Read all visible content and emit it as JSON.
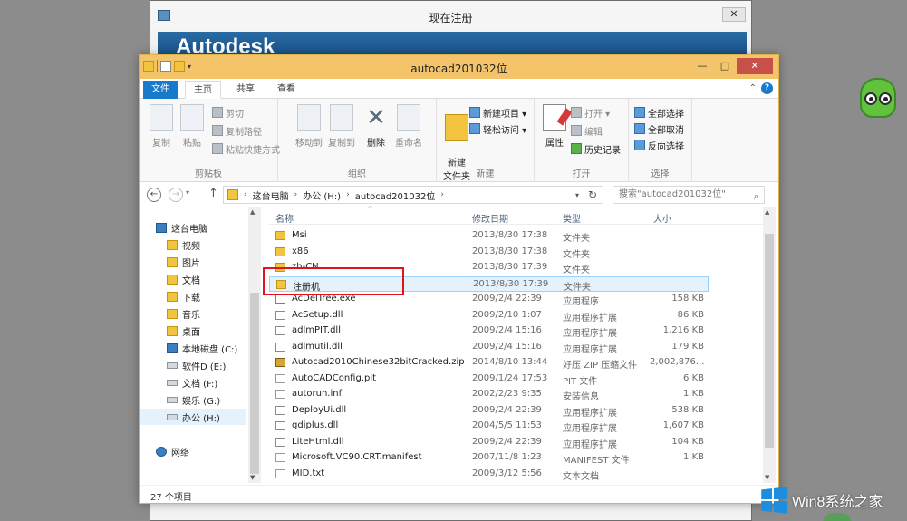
{
  "background_dialog": {
    "title": "现在注册",
    "close": "✕",
    "banner": "Autodesk"
  },
  "window": {
    "title": "autocad201032位",
    "controls": {
      "minimize": "—",
      "maximize": "□",
      "close": "✕"
    }
  },
  "tabs": {
    "file": "文件",
    "home": "主页",
    "share": "共享",
    "view": "查看",
    "ribbon_collapse": "⌃",
    "help": "?"
  },
  "ribbon": {
    "clipboard": {
      "copy": "复制",
      "paste": "粘贴",
      "cut": "剪切",
      "copy_path": "复制路径",
      "paste_shortcut": "粘贴快捷方式",
      "label": "剪贴板"
    },
    "organize": {
      "move_to": "移动到",
      "copy_to": "复制到",
      "delete": "删除",
      "rename": "重命名",
      "label": "组织"
    },
    "new": {
      "new_folder": "新建\n文件夹",
      "new_item": "新建项目 ▾",
      "easy_access": "轻松访问 ▾",
      "label": "新建"
    },
    "open": {
      "properties": "属性",
      "open": "打开 ▾",
      "edit": "编辑",
      "history": "历史记录",
      "label": "打开"
    },
    "select": {
      "select_all": "全部选择",
      "select_none": "全部取消",
      "invert": "反向选择",
      "label": "选择"
    }
  },
  "address": {
    "back": "←",
    "forward": "→",
    "recent": "▾",
    "up": "↑",
    "segments": [
      "这台电脑",
      "办公 (H:)",
      "autocad201032位"
    ],
    "separator": "›",
    "dropdown": "▾",
    "refresh": "↻",
    "search_placeholder": "搜索\"autocad201032位\"",
    "search_icon": "⌕"
  },
  "nav": {
    "items": [
      {
        "label": "这台电脑",
        "icon": "pc"
      },
      {
        "label": "视频",
        "icon": "folder"
      },
      {
        "label": "图片",
        "icon": "folder"
      },
      {
        "label": "文档",
        "icon": "folder"
      },
      {
        "label": "下载",
        "icon": "folder"
      },
      {
        "label": "音乐",
        "icon": "folder"
      },
      {
        "label": "桌面",
        "icon": "folder"
      },
      {
        "label": "本地磁盘 (C:)",
        "icon": "drive-c"
      },
      {
        "label": "软件D (E:)",
        "icon": "drive"
      },
      {
        "label": "文档 (F:)",
        "icon": "drive"
      },
      {
        "label": "娱乐 (G:)",
        "icon": "drive"
      },
      {
        "label": "办公 (H:)",
        "icon": "drive"
      },
      {
        "label": "网络",
        "icon": "net"
      }
    ],
    "selected": "办公 (H:)"
  },
  "columns": {
    "name": "名称",
    "modified": "修改日期",
    "type": "类型",
    "size": "大小"
  },
  "files": [
    {
      "name": "Msi",
      "date": "2013/8/30 17:38",
      "type": "文件夹",
      "size": "",
      "icon": "folder"
    },
    {
      "name": "x86",
      "date": "2013/8/30 17:38",
      "type": "文件夹",
      "size": "",
      "icon": "folder"
    },
    {
      "name": "zh-CN",
      "date": "2013/8/30 17:39",
      "type": "文件夹",
      "size": "",
      "icon": "folder"
    },
    {
      "name": "注册机",
      "date": "2013/8/30 17:39",
      "type": "文件夹",
      "size": "",
      "icon": "folder"
    },
    {
      "name": "AcDelTree.exe",
      "date": "2009/2/4 22:39",
      "type": "应用程序",
      "size": "158 KB",
      "icon": "exe"
    },
    {
      "name": "AcSetup.dll",
      "date": "2009/2/10 1:07",
      "type": "应用程序扩展",
      "size": "86 KB",
      "icon": "dll"
    },
    {
      "name": "adlmPIT.dll",
      "date": "2009/2/4 15:16",
      "type": "应用程序扩展",
      "size": "1,216 KB",
      "icon": "dll"
    },
    {
      "name": "adlmutil.dll",
      "date": "2009/2/4 15:16",
      "type": "应用程序扩展",
      "size": "179 KB",
      "icon": "dll"
    },
    {
      "name": "Autocad2010Chinese32bitCracked.zip",
      "date": "2014/8/10 13:44",
      "type": "好压 ZIP 压缩文件",
      "size": "2,002,876...",
      "icon": "zip"
    },
    {
      "name": "AutoCADConfig.pit",
      "date": "2009/1/24 17:53",
      "type": "PIT 文件",
      "size": "6 KB",
      "icon": "txt"
    },
    {
      "name": "autorun.inf",
      "date": "2002/2/23 9:35",
      "type": "安装信息",
      "size": "1 KB",
      "icon": "txt"
    },
    {
      "name": "DeployUi.dll",
      "date": "2009/2/4 22:39",
      "type": "应用程序扩展",
      "size": "538 KB",
      "icon": "dll"
    },
    {
      "name": "gdiplus.dll",
      "date": "2004/5/5 11:53",
      "type": "应用程序扩展",
      "size": "1,607 KB",
      "icon": "dll"
    },
    {
      "name": "LiteHtml.dll",
      "date": "2009/2/4 22:39",
      "type": "应用程序扩展",
      "size": "104 KB",
      "icon": "dll"
    },
    {
      "name": "Microsoft.VC90.CRT.manifest",
      "date": "2007/11/8 1:23",
      "type": "MANIFEST 文件",
      "size": "1 KB",
      "icon": "txt"
    },
    {
      "name": "MID.txt",
      "date": "2009/3/12 5:56",
      "type": "文本文档",
      "size": "",
      "icon": "txt"
    }
  ],
  "selected_file": "注册机",
  "status": {
    "count": "27 个项目"
  },
  "watermark": {
    "text": "Win8系统之家"
  }
}
